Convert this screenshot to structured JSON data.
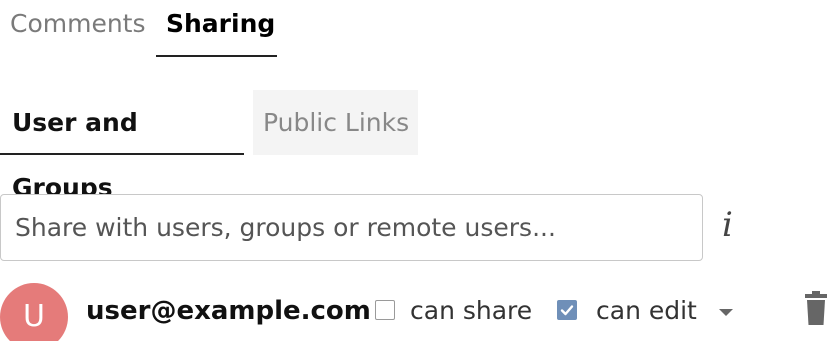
{
  "tabs": {
    "comments": "Comments",
    "sharing": "Sharing",
    "active": "Sharing"
  },
  "subtabs": {
    "users_groups": "User and Groups",
    "public_links": "Public Links",
    "active": "User and Groups"
  },
  "share_input": {
    "placeholder": "Share with users, groups or remote users...",
    "value": ""
  },
  "icons": {
    "info": "info-icon",
    "trash": "trash-icon",
    "caret": "chevron-down-icon"
  },
  "share_entry": {
    "avatar_letter": "U",
    "avatar_color": "#e57b7a",
    "email": "user@example.com",
    "can_share": {
      "label": "can share",
      "checked": false
    },
    "can_edit": {
      "label": "can edit",
      "checked": true
    },
    "checkbox_color": "#6f8fb8"
  },
  "info_glyph": "i"
}
